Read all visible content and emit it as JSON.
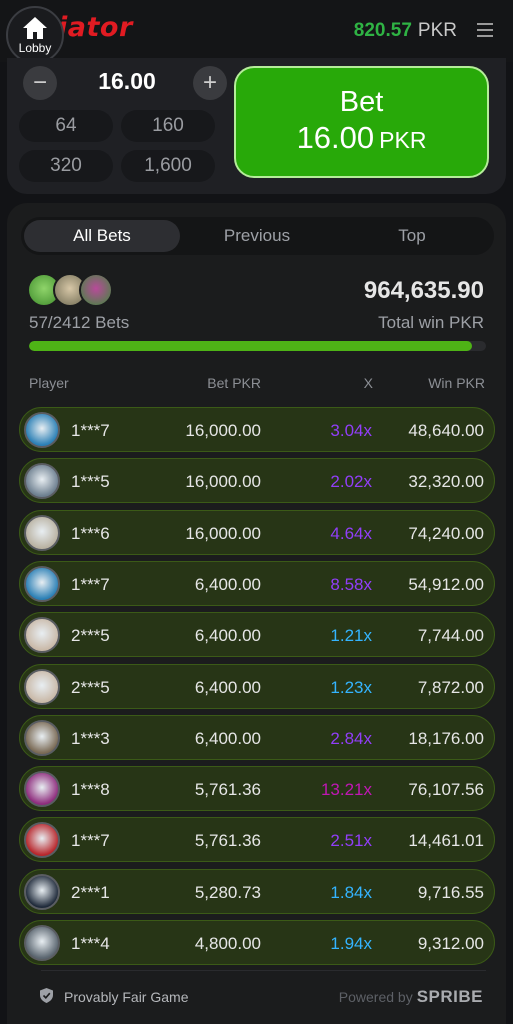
{
  "header": {
    "logo_text": "Aviator",
    "lobby_label": "Lobby",
    "balance_amount": "820.57",
    "balance_currency": "PKR",
    "colors": {
      "brand": "#e11b22",
      "balance": "#2fb344"
    }
  },
  "bet_panel": {
    "minus_label": "−",
    "plus_label": "+",
    "amount": "16.00",
    "quick_amounts": [
      "64",
      "160",
      "320",
      "1,600"
    ],
    "bet_label": "Bet",
    "bet_amount": "16.00",
    "bet_currency": "PKR",
    "bet_button_color": "#28a909"
  },
  "tabs": [
    {
      "label": "All Bets",
      "active": true
    },
    {
      "label": "Previous",
      "active": false
    },
    {
      "label": "Top",
      "active": false
    }
  ],
  "stats": {
    "bets_count": "57/2412 Bets",
    "total_win": "964,635.90",
    "total_label": "Total win PKR",
    "progress": 0.97
  },
  "columns": {
    "player": "Player",
    "bet": "Bet PKR",
    "x": "X",
    "win": "Win PKR"
  },
  "multiplier_colors": {
    "blue": "#34b4ff",
    "purple": "#913ef8",
    "magenta": "#c017b4"
  },
  "rows": [
    {
      "player": "1***7",
      "bet": "16,000.00",
      "x": "3.04x",
      "win": "48,640.00",
      "tier": "purple",
      "avatar_color": "#2a7fb5"
    },
    {
      "player": "1***5",
      "bet": "16,000.00",
      "x": "2.02x",
      "win": "32,320.00",
      "tier": "purple",
      "avatar_color": "#6d7f8f"
    },
    {
      "player": "1***6",
      "bet": "16,000.00",
      "x": "4.64x",
      "win": "74,240.00",
      "tier": "purple",
      "avatar_color": "#b9b2a2"
    },
    {
      "player": "1***7",
      "bet": "6,400.00",
      "x": "8.58x",
      "win": "54,912.00",
      "tier": "purple",
      "avatar_color": "#2a7fb5"
    },
    {
      "player": "2***5",
      "bet": "6,400.00",
      "x": "1.21x",
      "win": "7,744.00",
      "tier": "blue",
      "avatar_color": "#c9b9a8"
    },
    {
      "player": "2***5",
      "bet": "6,400.00",
      "x": "1.23x",
      "win": "7,872.00",
      "tier": "blue",
      "avatar_color": "#c9b9a8"
    },
    {
      "player": "1***3",
      "bet": "6,400.00",
      "x": "2.84x",
      "win": "18,176.00",
      "tier": "purple",
      "avatar_color": "#7a6a55"
    },
    {
      "player": "1***8",
      "bet": "5,761.36",
      "x": "13.21x",
      "win": "76,107.56",
      "tier": "magenta",
      "avatar_color": "#8e2c7d"
    },
    {
      "player": "1***7",
      "bet": "5,761.36",
      "x": "2.51x",
      "win": "14,461.01",
      "tier": "purple",
      "avatar_color": "#b8262b"
    },
    {
      "player": "2***1",
      "bet": "5,280.73",
      "x": "1.84x",
      "win": "9,716.55",
      "tier": "blue",
      "avatar_color": "#1f2a3a"
    },
    {
      "player": "1***4",
      "bet": "4,800.00",
      "x": "1.94x",
      "win": "9,312.00",
      "tier": "blue",
      "avatar_color": "#5b6670"
    }
  ],
  "footer": {
    "fair_label": "Provably Fair Game",
    "powered_label": "Powered by",
    "brand": "SPRIBE"
  }
}
